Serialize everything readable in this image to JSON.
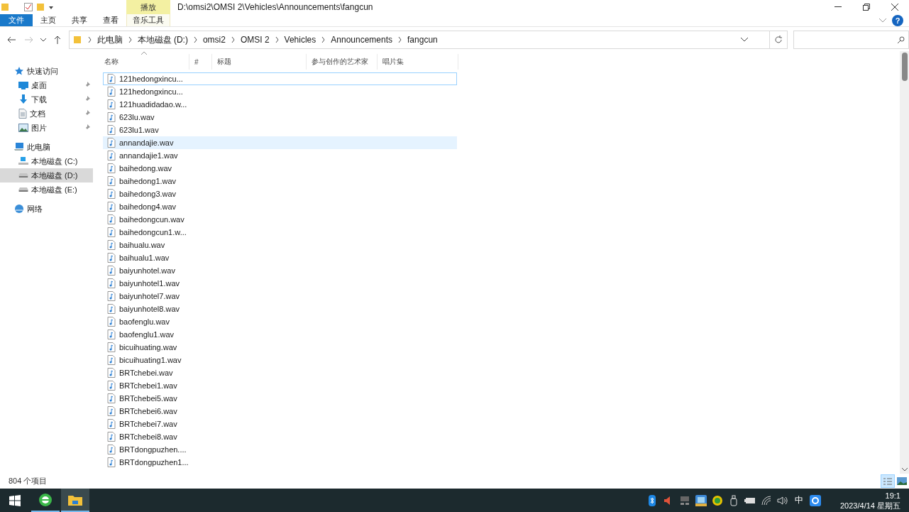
{
  "title_bar": {
    "contextual_group": "播放",
    "title": "D:\\omsi2\\OMSI 2\\Vehicles\\Announcements\\fangcun"
  },
  "ribbon": {
    "tabs": [
      {
        "label": "文件",
        "kind": "file"
      },
      {
        "label": "主页",
        "kind": "tab"
      },
      {
        "label": "共享",
        "kind": "tab"
      },
      {
        "label": "查看",
        "kind": "tab"
      },
      {
        "label": "音乐工具",
        "kind": "contextual"
      }
    ],
    "help_button": "?"
  },
  "address_bar": {
    "breadcrumbs": [
      "此电脑",
      "本地磁盘 (D:)",
      "omsi2",
      "OMSI 2",
      "Vehicles",
      "Announcements",
      "fangcun"
    ]
  },
  "navigation": [
    {
      "label": "快速访问",
      "selected": false,
      "children": [
        {
          "label": "桌面",
          "pinned": true,
          "selected": false
        },
        {
          "label": "下载",
          "pinned": true,
          "selected": false
        },
        {
          "label": "文档",
          "pinned": true,
          "selected": false
        },
        {
          "label": "图片",
          "pinned": true,
          "selected": false
        }
      ]
    },
    {
      "label": "此电脑",
      "selected": false,
      "children": [
        {
          "label": "本地磁盘 (C:)",
          "pinned": false,
          "selected": false
        },
        {
          "label": "本地磁盘 (D:)",
          "pinned": false,
          "selected": true
        },
        {
          "label": "本地磁盘 (E:)",
          "pinned": false,
          "selected": false
        }
      ]
    },
    {
      "label": "网络",
      "selected": false
    }
  ],
  "columns": [
    {
      "label": "名称",
      "sorted": true
    },
    {
      "label": "#",
      "sorted": false
    },
    {
      "label": "标题",
      "sorted": false
    },
    {
      "label": "参与创作的艺术家",
      "sorted": false
    },
    {
      "label": "唱片集",
      "sorted": false
    }
  ],
  "files": [
    {
      "name": "121hedongxincu...",
      "focused": true,
      "highlighted": false
    },
    {
      "name": "121hedongxincu...",
      "focused": false,
      "highlighted": false
    },
    {
      "name": "121huadidadao.w...",
      "focused": false,
      "highlighted": false
    },
    {
      "name": "623lu.wav",
      "focused": false,
      "highlighted": false
    },
    {
      "name": "623lu1.wav",
      "focused": false,
      "highlighted": false
    },
    {
      "name": "annandajie.wav",
      "focused": false,
      "highlighted": true
    },
    {
      "name": "annandajie1.wav",
      "focused": false,
      "highlighted": false
    },
    {
      "name": "baihedong.wav",
      "focused": false,
      "highlighted": false
    },
    {
      "name": "baihedong1.wav",
      "focused": false,
      "highlighted": false
    },
    {
      "name": "baihedong3.wav",
      "focused": false,
      "highlighted": false
    },
    {
      "name": "baihedong4.wav",
      "focused": false,
      "highlighted": false
    },
    {
      "name": "baihedongcun.wav",
      "focused": false,
      "highlighted": false
    },
    {
      "name": "baihedongcun1.w...",
      "focused": false,
      "highlighted": false
    },
    {
      "name": "baihualu.wav",
      "focused": false,
      "highlighted": false
    },
    {
      "name": "baihualu1.wav",
      "focused": false,
      "highlighted": false
    },
    {
      "name": "baiyunhotel.wav",
      "focused": false,
      "highlighted": false
    },
    {
      "name": "baiyunhotel1.wav",
      "focused": false,
      "highlighted": false
    },
    {
      "name": "baiyunhotel7.wav",
      "focused": false,
      "highlighted": false
    },
    {
      "name": "baiyunhotel8.wav",
      "focused": false,
      "highlighted": false
    },
    {
      "name": "baofenglu.wav",
      "focused": false,
      "highlighted": false
    },
    {
      "name": "baofenglu1.wav",
      "focused": false,
      "highlighted": false
    },
    {
      "name": "bicuihuating.wav",
      "focused": false,
      "highlighted": false
    },
    {
      "name": "bicuihuating1.wav",
      "focused": false,
      "highlighted": false
    },
    {
      "name": "BRTchebei.wav",
      "focused": false,
      "highlighted": false
    },
    {
      "name": "BRTchebei1.wav",
      "focused": false,
      "highlighted": false
    },
    {
      "name": "BRTchebei5.wav",
      "focused": false,
      "highlighted": false
    },
    {
      "name": "BRTchebei6.wav",
      "focused": false,
      "highlighted": false
    },
    {
      "name": "BRTchebei7.wav",
      "focused": false,
      "highlighted": false
    },
    {
      "name": "BRTchebei8.wav",
      "focused": false,
      "highlighted": false
    },
    {
      "name": "BRTdongpuzhen....",
      "focused": false,
      "highlighted": false
    },
    {
      "name": "BRTdongpuzhen1...",
      "focused": false,
      "highlighted": false
    }
  ],
  "status_bar": {
    "item_count": "804 个项目",
    "views": [
      {
        "kind": "details",
        "selected": true
      },
      {
        "kind": "large-icons",
        "selected": false
      }
    ]
  },
  "taskbar": {
    "apps": [
      {
        "kind": "browser",
        "active": false
      },
      {
        "kind": "explorer",
        "active": true
      }
    ],
    "tray": [
      {
        "kind": "bluetooth"
      },
      {
        "kind": "speaker"
      },
      {
        "kind": "device"
      },
      {
        "kind": "blue-app"
      },
      {
        "kind": "green-app"
      },
      {
        "kind": "usb"
      },
      {
        "kind": "battery"
      },
      {
        "kind": "wifi"
      },
      {
        "kind": "volume"
      },
      {
        "kind": "ime",
        "label": "中"
      },
      {
        "kind": "search-app"
      }
    ],
    "time": "19:1",
    "date": "2023/4/14 星期五"
  }
}
